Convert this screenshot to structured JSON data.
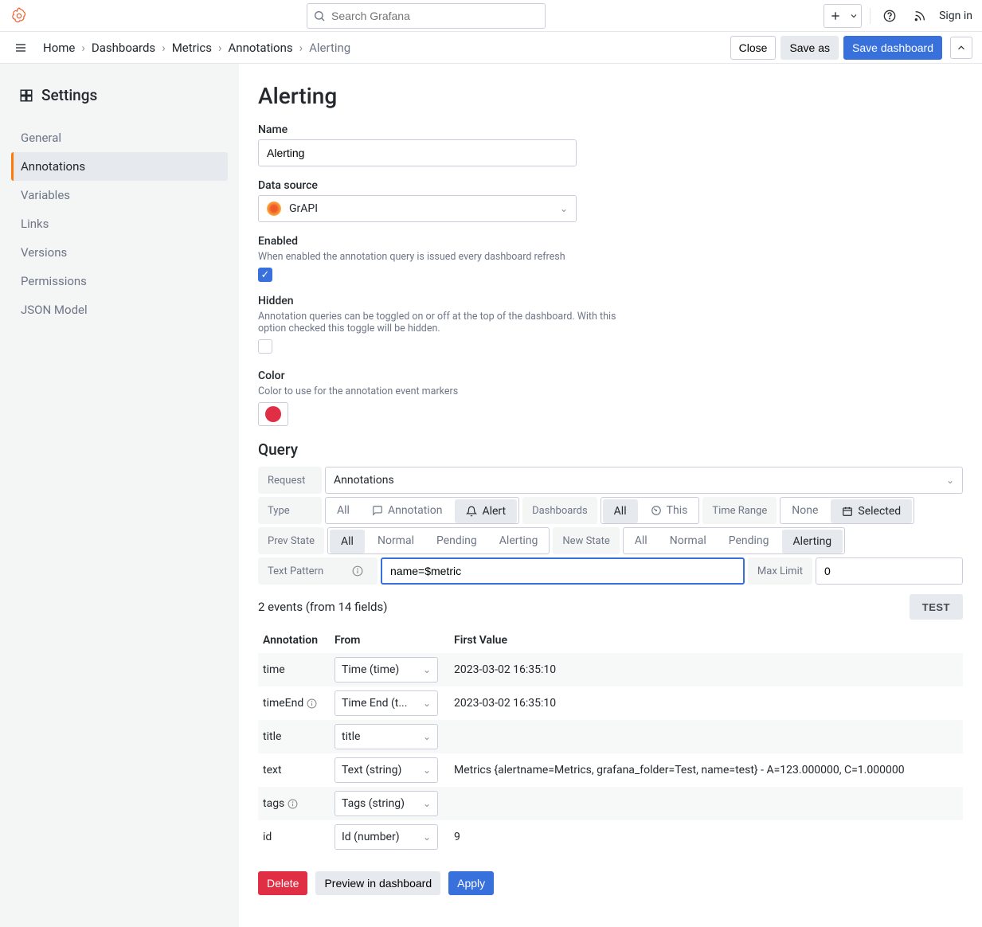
{
  "topbar": {
    "search_placeholder": "Search Grafana",
    "signin": "Sign in"
  },
  "breadcrumb": {
    "items": [
      "Home",
      "Dashboards",
      "Metrics",
      "Annotations"
    ],
    "last": "Alerting",
    "close": "Close",
    "save_as": "Save as",
    "save_dashboard": "Save dashboard"
  },
  "sidebar": {
    "title": "Settings",
    "items": [
      {
        "label": "General",
        "active": false
      },
      {
        "label": "Annotations",
        "active": true
      },
      {
        "label": "Variables",
        "active": false
      },
      {
        "label": "Links",
        "active": false
      },
      {
        "label": "Versions",
        "active": false
      },
      {
        "label": "Permissions",
        "active": false
      },
      {
        "label": "JSON Model",
        "active": false
      }
    ]
  },
  "page": {
    "title": "Alerting",
    "name": {
      "label": "Name",
      "value": "Alerting"
    },
    "datasource": {
      "label": "Data source",
      "value": "GrAPI"
    },
    "enabled": {
      "label": "Enabled",
      "desc": "When enabled the annotation query is issued every dashboard refresh",
      "checked": true
    },
    "hidden": {
      "label": "Hidden",
      "desc": "Annotation queries can be toggled on or off at the top of the dashboard. With this option checked this toggle will be hidden.",
      "checked": false
    },
    "color": {
      "label": "Color",
      "desc": "Color to use for the annotation event markers",
      "value": "#e02f44"
    }
  },
  "query": {
    "title": "Query",
    "request": {
      "label": "Request",
      "value": "Annotations"
    },
    "type": {
      "label": "Type",
      "opts": [
        "All",
        "Annotation",
        "Alert"
      ],
      "selected": "Alert",
      "dash_label": "Dashboards",
      "dash_opts": [
        "All",
        "This"
      ],
      "dash_selected": "All",
      "time_label": "Time Range",
      "time_opts": [
        "None",
        "Selected"
      ],
      "time_selected": "Selected"
    },
    "prev_state": {
      "label": "Prev State",
      "opts": [
        "All",
        "Normal",
        "Pending",
        "Alerting"
      ],
      "selected": "All"
    },
    "new_state": {
      "label": "New State",
      "opts": [
        "All",
        "Normal",
        "Pending",
        "Alerting"
      ],
      "selected": "Alerting"
    },
    "text_pattern": {
      "label": "Text Pattern",
      "value": "name=$metric"
    },
    "max_limit": {
      "label": "Max Limit",
      "value": "0"
    },
    "events_text": "2 events (from 14 fields)",
    "test": "TEST"
  },
  "table": {
    "headers": [
      "Annotation",
      "From",
      "First Value"
    ],
    "rows": [
      {
        "annotation": "time",
        "from": "Time (time)",
        "value": "2023-03-02 16:35:10"
      },
      {
        "annotation": "timeEnd",
        "from": "Time End (t...",
        "value": "2023-03-02 16:35:10",
        "info": true
      },
      {
        "annotation": "title",
        "from": "title",
        "value": ""
      },
      {
        "annotation": "text",
        "from": "Text (string)",
        "value": "Metrics {alertname=Metrics, grafana_folder=Test, name=test} - A=123.000000, C=1.000000"
      },
      {
        "annotation": "tags",
        "from": "Tags (string)",
        "value": "",
        "info": true
      },
      {
        "annotation": "id",
        "from": "Id (number)",
        "value": "9"
      }
    ]
  },
  "actions": {
    "delete": "Delete",
    "preview": "Preview in dashboard",
    "apply": "Apply"
  }
}
